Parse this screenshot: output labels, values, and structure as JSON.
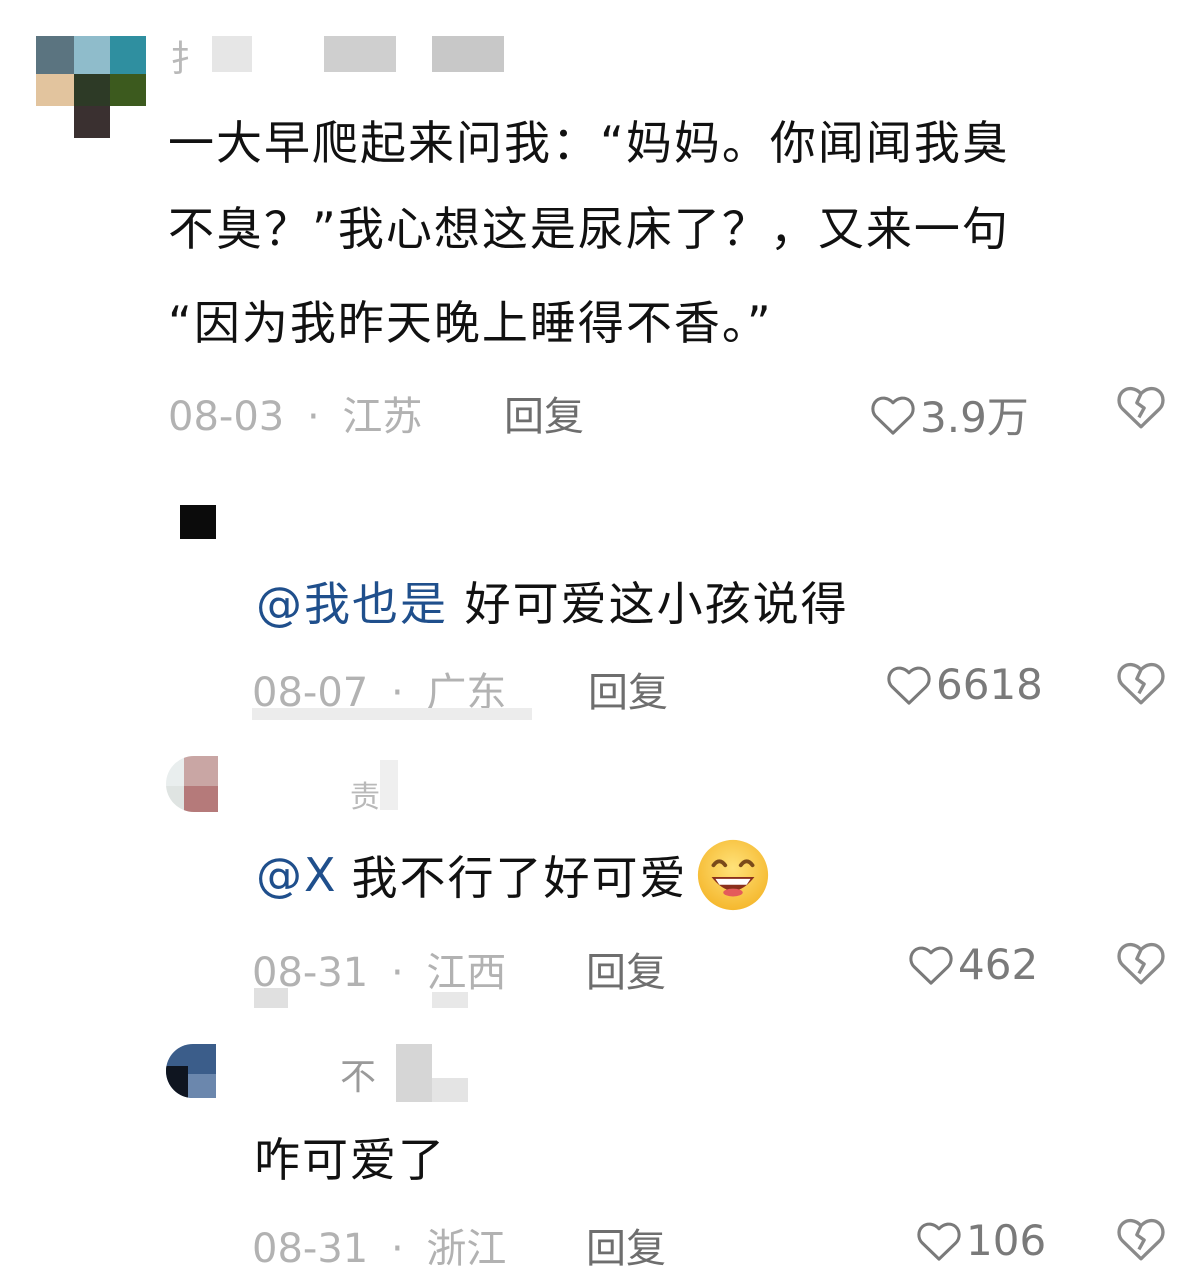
{
  "comments": [
    {
      "name": "扌",
      "text_lines": [
        "一大早爬起来问我：“妈妈。你闻闻我臭",
        "不臭？”我心想这是尿床了？，又来一句",
        "“因为我昨天晚上睡得不香。”"
      ],
      "date": "08-03",
      "region": "江苏",
      "reply_label": "回复",
      "likes": "3.9万"
    },
    {
      "name": "",
      "mention": "@我也是",
      "text": "好可爱这小孩说得",
      "date": "08-07",
      "region": "广东",
      "reply_label": "回复",
      "likes": "6618"
    },
    {
      "name": "责",
      "mention": "@X",
      "text": "我不行了好可爱",
      "emoji": "grinning-face-emoji",
      "date": "08-31",
      "region": "江西",
      "reply_label": "回复",
      "likes": "462"
    },
    {
      "name": "不",
      "text": "咋可爱了",
      "date": "08-31",
      "region": "浙江",
      "reply_label": "回复",
      "likes": "106"
    }
  ],
  "separator": "·",
  "icons": {
    "like": "heart-outline-icon",
    "dislike": "broken-heart-icon"
  },
  "colors": {
    "mention": "#1f4f8c",
    "meta": "#b2b2b2",
    "reply": "#6e6e6e"
  }
}
